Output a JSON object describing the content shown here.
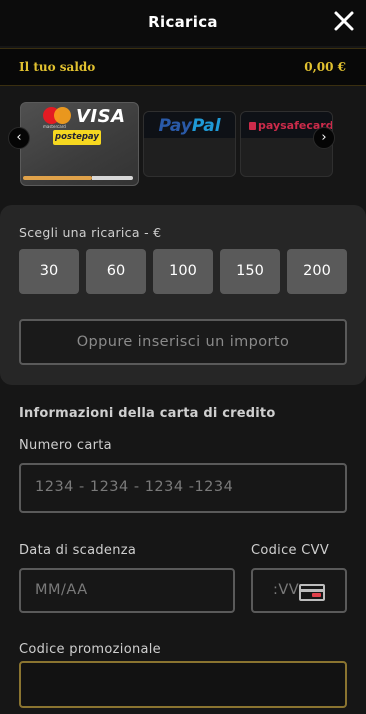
{
  "header": {
    "title": "Ricarica",
    "close_icon": "close-icon"
  },
  "balance": {
    "label": "Il tuo saldo",
    "amount": "0,00 €",
    "color": "#e2c230"
  },
  "payment_methods": {
    "selected": "visa",
    "cards": [
      {
        "id": "visa",
        "brand_text": "VISA",
        "mc_text": "mastercard",
        "postepay_text": "postepay",
        "progress": 0.63
      },
      {
        "id": "paypal",
        "brand_text_1": "Pay",
        "brand_text_2": "Pal"
      },
      {
        "id": "paysafecard",
        "brand_text": "paysafecard"
      }
    ],
    "prev_icon": "chevron-left-icon",
    "next_icon": "chevron-right-icon"
  },
  "recharge": {
    "label": "Scegli una ricarica - €",
    "amounts": [
      "30",
      "60",
      "100",
      "150",
      "200"
    ],
    "other_amount": "Oppure inserisci un importo"
  },
  "card_info": {
    "section_title": "Informazioni della carta di credito",
    "card_number": {
      "label": "Numero carta",
      "placeholder": "1234 - 1234 - 1234 -1234"
    },
    "expiry": {
      "label": "Data di scadenza",
      "placeholder": "MM/AA"
    },
    "cvv": {
      "label": "Codice CVV",
      "placeholder": ":VV"
    },
    "promo": {
      "label": "Codice promozionale",
      "value": ""
    }
  }
}
